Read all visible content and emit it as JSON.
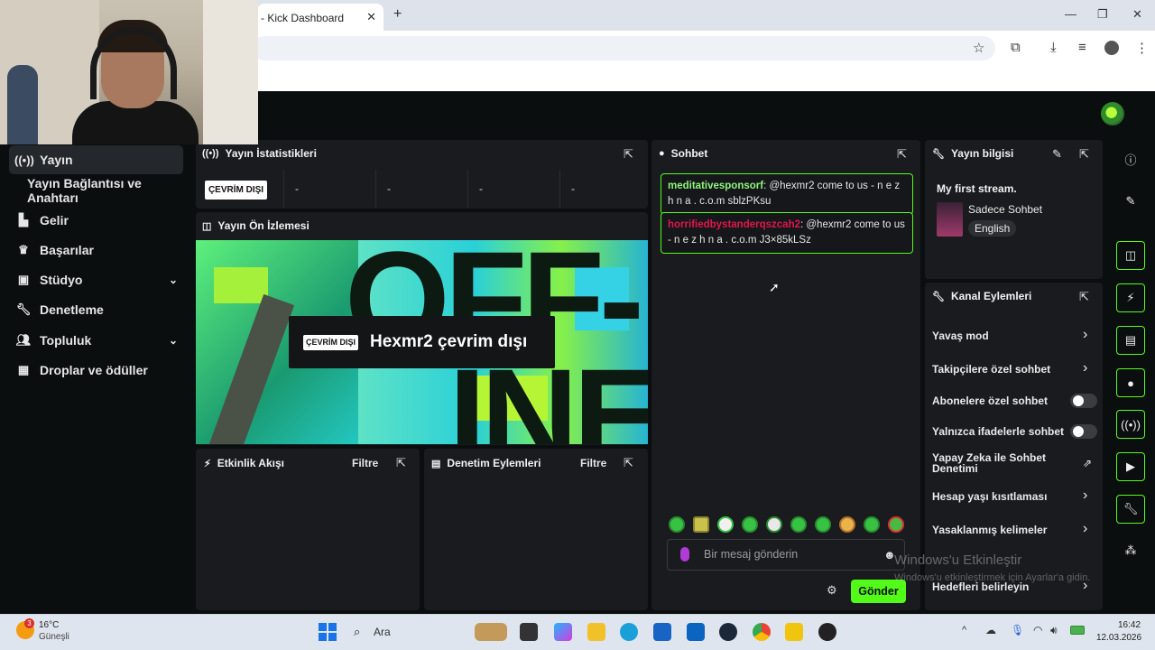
{
  "browser": {
    "tab_title": "- Kick Dashboard",
    "tab_close": "✕",
    "new_tab": "+",
    "window_controls": [
      "—",
      "❐",
      "✕"
    ]
  },
  "sidebar": {
    "items": [
      {
        "label": "Yayın",
        "icon": "broadcast-icon"
      },
      {
        "label": "Yayın Bağlantısı ve Anahtarı",
        "icon": ""
      },
      {
        "label": "Gelir",
        "icon": "chart-icon"
      },
      {
        "label": "Başarılar",
        "icon": "trophy-icon"
      },
      {
        "label": "Stüdyo",
        "icon": "studio-icon"
      },
      {
        "label": "Denetleme",
        "icon": "wrench-icon"
      },
      {
        "label": "Topluluk",
        "icon": "people-icon"
      },
      {
        "label": "Droplar ve ödüller",
        "icon": "gift-icon"
      }
    ]
  },
  "stats": {
    "title": "Yayın İstatistikleri",
    "status": "ÇEVRİM DIŞI",
    "values": [
      "-",
      "-",
      "-",
      "-"
    ]
  },
  "preview": {
    "title": "Yayın Ön İzlemesi",
    "overlay_big": "OFF-",
    "overlay_big2": "INE",
    "chip": "ÇEVRİM DIŞI",
    "message": "Hexmr2 çevrim dışı"
  },
  "activity": {
    "title": "Etkinlik Akışı",
    "filter": "Filtre"
  },
  "moderation": {
    "title": "Denetim Eylemleri",
    "filter": "Filtre"
  },
  "chat": {
    "title": "Sohbet",
    "messages": [
      {
        "user": "meditativesponsorf",
        "text": ": @hexmr2 come to us - n e z h n a . c.o.m sblzPKsu"
      },
      {
        "user": "horrifiedbystanderqszcah2",
        "text": ": @hexmr2 come to us - n e z h n a . c.o.m J3×85kLSz"
      }
    ],
    "placeholder": "Bir mesaj gönderin",
    "send": "Gönder"
  },
  "stream_info": {
    "title": "Yayın bilgisi",
    "stream_title": "My first stream.",
    "category": "Sadece Sohbet",
    "language": "English"
  },
  "channel_actions": {
    "title": "Kanal Eylemleri",
    "items": [
      {
        "label": "Yavaş mod",
        "control": "arrow"
      },
      {
        "label": "Takipçilere özel sohbet",
        "control": "arrow"
      },
      {
        "label": "Abonelere özel sohbet",
        "control": "toggle"
      },
      {
        "label": "Yalnızca ifadelerle sohbet",
        "control": "toggle"
      },
      {
        "label": "Yapay Zeka ile Sohbet",
        "label2": "Denetimi",
        "control": "external"
      },
      {
        "label": "Hesap yaşı kısıtlaması",
        "control": "arrow"
      },
      {
        "label": "Yasaklanmış kelimeler",
        "control": "arrow"
      },
      {
        "label": "Hedefleri belirleyin",
        "control": "arrow"
      }
    ]
  },
  "watermark": {
    "line1": "Windows'u Etkinleştir",
    "line2": "Windows'u etkinleştirmek için Ayarlar'a gidin."
  },
  "taskbar": {
    "temp": "16°C",
    "weather": "Güneşli",
    "weather_badge": "3",
    "search": "Ara",
    "time": "16:42",
    "date": "12.03.2026"
  },
  "colors": {
    "accent": "#53fc18",
    "panel": "#191b1f",
    "bg": "#0b0e0f"
  }
}
